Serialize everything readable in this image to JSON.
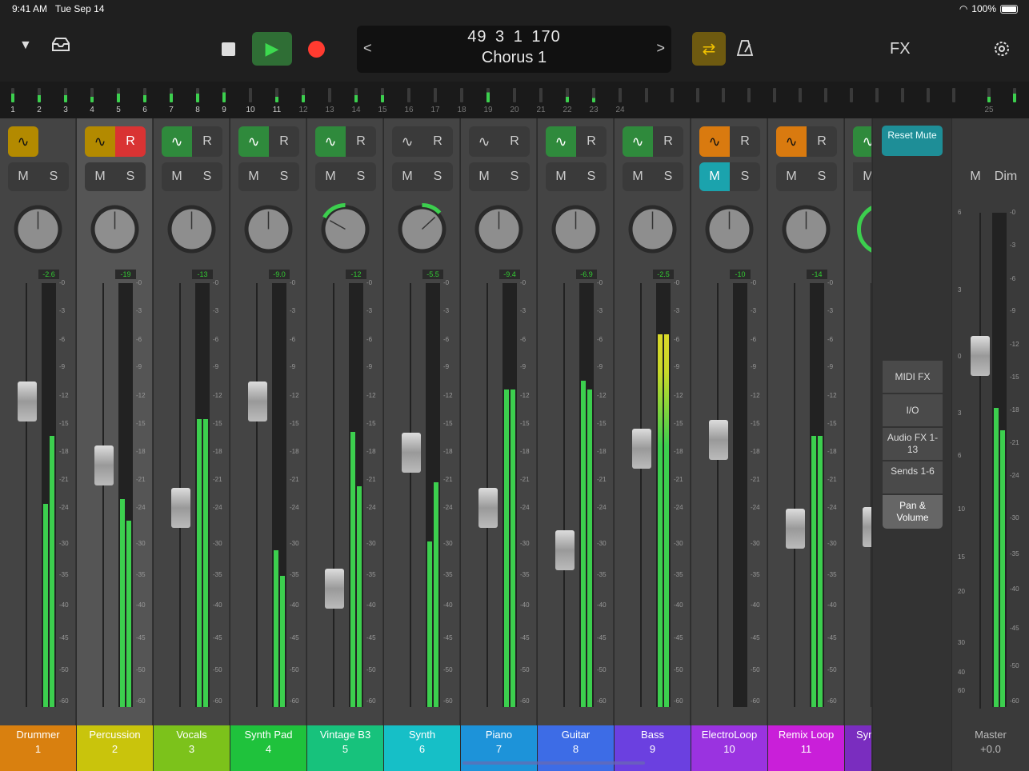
{
  "status": {
    "time": "9:41 AM",
    "date": "Tue Sep 14",
    "battery": "100%"
  },
  "toolbar": {
    "position": "49  3  1  170",
    "section": "Chorus 1",
    "fx_label": "FX",
    "colors": {
      "play": "#2f9e3f",
      "record": "#ff3b30",
      "cycle": "#6e5a10"
    }
  },
  "ruler": {
    "numbers": [
      "1",
      "2",
      "3",
      "4",
      "5",
      "6",
      "7",
      "8",
      "9",
      "10",
      "11",
      "12",
      "13",
      "14",
      "15",
      "16",
      "17",
      "18",
      "19",
      "20",
      "21",
      "22",
      "23",
      "24",
      "25"
    ]
  },
  "channels": [
    {
      "name": "Drummer",
      "num": "1",
      "db": "-2.6",
      "auto_color": "#b38a00",
      "auto_text": "#111",
      "r": false,
      "mute": false,
      "color": "#d9800f",
      "meterL": 0.48,
      "meterR": 0.64,
      "fader": 0.72,
      "pan": 0
    },
    {
      "name": "Percussion",
      "num": "2",
      "db": "-19",
      "auto_color": "#b38a00",
      "auto_text": "#111",
      "r": true,
      "mute": false,
      "color": "#c9c40c",
      "meterL": 0.49,
      "meterR": 0.44,
      "fader": 0.57,
      "pan": 0
    },
    {
      "name": "Vocals",
      "num": "3",
      "db": "-13",
      "auto_color": "#2f8a3c",
      "auto_text": "#fff",
      "r": false,
      "mute": false,
      "color": "#7cc21b",
      "meterL": 0.68,
      "meterR": 0.68,
      "fader": 0.47,
      "pan": 0
    },
    {
      "name": "Synth Pad",
      "num": "4",
      "db": "-9.0",
      "auto_color": "#2f8a3c",
      "auto_text": "#fff",
      "r": false,
      "mute": false,
      "color": "#1fc23c",
      "meterL": 0.37,
      "meterR": 0.31,
      "fader": 0.72,
      "pan": 0
    },
    {
      "name": "Vintage B3",
      "num": "5",
      "db": "-12",
      "auto_color": "#2f8a3c",
      "auto_text": "#fff",
      "r": false,
      "mute": false,
      "color": "#17c27c",
      "meterL": 0.65,
      "meterR": 0.52,
      "fader": 0.28,
      "pan": -0.45
    },
    {
      "name": "Synth",
      "num": "6",
      "db": "-5.5",
      "auto_color": "#3a3a3a",
      "auto_text": "#ccc",
      "r": false,
      "mute": false,
      "color": "#16bfc7",
      "meterL": 0.39,
      "meterR": 0.53,
      "fader": 0.6,
      "pan": 0.35
    },
    {
      "name": "Piano",
      "num": "7",
      "db": "-9.4",
      "auto_color": "#3a3a3a",
      "auto_text": "#ccc",
      "r": false,
      "mute": false,
      "color": "#1d93d9",
      "meterL": 0.75,
      "meterR": 0.75,
      "fader": 0.47,
      "pan": 0
    },
    {
      "name": "Guitar",
      "num": "8",
      "db": "-6.9",
      "auto_color": "#2f8a3c",
      "auto_text": "#fff",
      "r": false,
      "mute": false,
      "color": "#3d6ce6",
      "meterL": 0.77,
      "meterR": 0.75,
      "fader": 0.37,
      "pan": 0
    },
    {
      "name": "Bass",
      "num": "9",
      "db": "-2.5",
      "auto_color": "#2f8a3c",
      "auto_text": "#fff",
      "r": false,
      "mute": false,
      "color": "#6b40e0",
      "meterL": 0.88,
      "meterR": 0.88,
      "fader": 0.61,
      "pan": 0
    },
    {
      "name": "ElectroLoop",
      "num": "10",
      "db": "-10",
      "auto_color": "#d97a0f",
      "auto_text": "#111",
      "r": false,
      "mute": true,
      "color": "#9a33e0",
      "meterL": 0.0,
      "meterR": 0.0,
      "fader": 0.63,
      "pan": 0
    },
    {
      "name": "Remix Loop",
      "num": "11",
      "db": "-14",
      "auto_color": "#d97a0f",
      "auto_text": "#111",
      "r": false,
      "mute": false,
      "color": "#c91fd9",
      "meterL": 0.64,
      "meterR": 0.64,
      "fader": 0.42,
      "pan": 0
    }
  ],
  "partial_channel": {
    "name": "Syn",
    "m": "M"
  },
  "side": {
    "reset_mute": "Reset Mute",
    "buttons": [
      "MIDI FX",
      "I/O",
      "Audio FX 1-13",
      "Sends 1-6",
      "Pan & Volume"
    ]
  },
  "master": {
    "name": "Master",
    "value": "+0.0",
    "m": "M",
    "dim": "Dim"
  },
  "scale_labels": [
    "0",
    "3",
    "6",
    "9",
    "12",
    "15",
    "18",
    "21",
    "24",
    "30",
    "35",
    "40",
    "45",
    "50",
    "60"
  ],
  "ms": {
    "m": "M",
    "s": "S",
    "r": "R"
  }
}
